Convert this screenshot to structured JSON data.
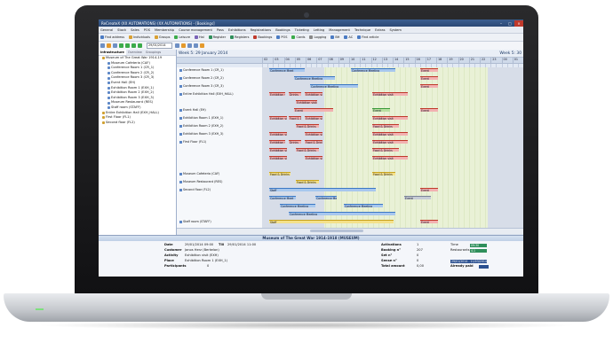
{
  "window": {
    "title": "ReCreateX (XX AUTOMATIONS) (XX AUTOMATIONS) - [Bookings]",
    "controls": [
      "–",
      "□",
      "×"
    ]
  },
  "menu": [
    "General",
    "Stock",
    "Sales",
    "POS",
    "Membership",
    "Course management",
    "Pass",
    "Exhibitions",
    "Registrations",
    "Bookings",
    "Ticketing",
    "Letting",
    "Management",
    "Technique",
    "Extras",
    "System"
  ],
  "toolbar": [
    "Find address",
    "Individuals",
    "Groups",
    "Leisure",
    "Hal",
    "Register",
    "Registers",
    "Bookings",
    "POS",
    "Cards",
    "Logging",
    "BH",
    "AC",
    "Find article"
  ],
  "date_value": "29/01/2014",
  "left_tabs": [
    "Infrastructure",
    "Overview",
    "Groupings"
  ],
  "tree": [
    "Museum of The Great War 1914-19",
    "Museum Cafeteria (CAF)",
    "Conference Room 1 (CR_1)",
    "Conference Room 2 (CR_2)",
    "Conference Room 3 (CR_3)",
    "Event Hall (EH)",
    "Exhibition Room 1 (EXH_1)",
    "Exhibition Room 2 (EXH_2)",
    "Exhibition Room 3 (EXH_3)",
    "Museum Restaurant (RES)",
    "Staff room (STAFF)",
    "Entire Exhibition Hall (EXH_HALL)",
    "First Floor (FL1)",
    "Second floor (FL2)"
  ],
  "week_label": "Week 5: 29 January 2014",
  "week_next": "Week 5: 30",
  "day_numbers": [
    "02",
    "03",
    "04",
    "05",
    "06",
    "07",
    "08",
    "09",
    "10",
    "11",
    "12",
    "13",
    "14",
    "15",
    "16",
    "17",
    "18",
    "19",
    "20",
    "21",
    "22",
    "23",
    "00",
    "01"
  ],
  "row_labels": [
    "Conference Room 1 (CR_1)",
    "Conference Room 2 (CR_2)",
    "Conference Room 3 (CR_3)",
    "Entire Exhibition Hall (EXH_HALL)",
    "",
    "Event Hall (EH)",
    "Exhibition Room 1 (EXH_1)",
    "Exhibition Room 2 (EXH_2)",
    "Exhibition Room 3 (EXH_3)",
    "First Floor (FL1)",
    "",
    "",
    "",
    "Museum Cafeteria (CAF)",
    "Museum Restaurant (RES)",
    "Second floor (FL2)",
    "",
    "",
    "",
    "Staff room (STAFF)"
  ],
  "bookings": {
    "conf_meet": "Conference Meet",
    "conf_meeting": "Conference Meeting",
    "event": "Event",
    "exh_visit": "Exhibition visit",
    "drinks": "Drinks",
    "food_drinks": "Food & Drinks",
    "staff": "Staff"
  },
  "details": {
    "title": "Museum of The Great War 1914-1918 (MUSEUM)",
    "date_label": "Date",
    "date_value": "29/01/2014 09:00",
    "till_label": "Till",
    "till_value": "29/01/2014 11:00",
    "customer_label": "Customer",
    "customer_value": "Janos Herz (Berkelon)",
    "activity_label": "Activity",
    "activity_value": "Exhibition visit (EXH)",
    "place_label": "Place",
    "place_value": "Exhibition Room 1 (EXH_1)",
    "participants_label": "Participants",
    "participants_value": "0",
    "activations_label": "Activations",
    "activations_value": "1",
    "booking_label": "Booking n°",
    "booking_value": "207",
    "set_label": "Set n°",
    "set_value": "0",
    "sense_label": "Sense n°",
    "sense_value": "0",
    "total_label": "Total amount",
    "total_value": "0,00",
    "time_label": "Time",
    "time_value": "09:30",
    "restaurants_label": "Restaurants",
    "restaurants_value": "4.1",
    "period_value": "29/01/2014 - 11/03/2014",
    "paid_label": "Already paid"
  }
}
